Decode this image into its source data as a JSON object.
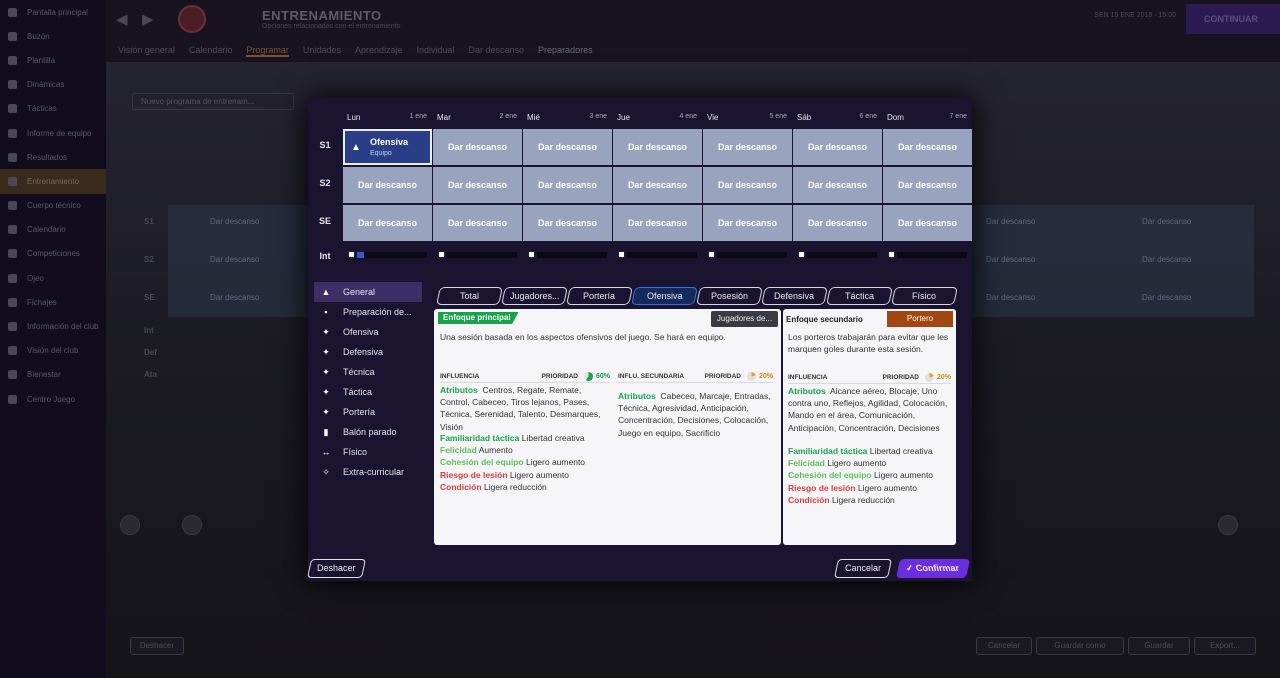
{
  "background": {
    "sidebar_items": [
      "Pantalla principal",
      "Buzón",
      "Plantilla",
      "Dinámicas",
      "Tácticas",
      "Informe de equipo",
      "Resultados",
      "Entrenamiento",
      "Cuerpo técnico",
      "Calendario",
      "Competiciones",
      "Ojeo",
      "Fichajes",
      "Información del club",
      "Visión del club",
      "Bienestar",
      "Centro Juego"
    ],
    "active_index": 7,
    "title": "ENTRENAMIENTO",
    "subtitle": "Opciones relacionadas con el entrenamiento",
    "top_right": "SEN   15 ENE 2018  ·  15:00",
    "confirm_label": "CONTINUAR",
    "tabs": [
      "Visión general",
      "Calendario",
      "Programar",
      "Unidades",
      "Aprendizaje",
      "Individual",
      "Dar descanso",
      "Preparadores"
    ],
    "active_tab_index": 2,
    "dropdown": "Nuevo programa de entrenam...",
    "row_labels": [
      "S1",
      "S2",
      "SE",
      "Int",
      "Def",
      "Ata"
    ],
    "cell_text": "Dar descanso",
    "bottom_buttons": [
      "Deshacer",
      "Cancelar",
      "Guardar como",
      "Guardar",
      "Export..."
    ]
  },
  "calendar": {
    "days": [
      {
        "name": "Lun",
        "date": "1 ene"
      },
      {
        "name": "Mar",
        "date": "2 ene"
      },
      {
        "name": "Mié",
        "date": "3 ene"
      },
      {
        "name": "Jue",
        "date": "4 ene"
      },
      {
        "name": "Vie",
        "date": "5 ene"
      },
      {
        "name": "Sáb",
        "date": "6 ene"
      },
      {
        "name": "Dom",
        "date": "7 ene"
      }
    ],
    "rows": [
      {
        "label": "S1",
        "cells": [
          "Ofensiva",
          "Dar descanso",
          "Dar descanso",
          "Dar descanso",
          "Dar descanso",
          "Dar descanso",
          "Dar descanso"
        ]
      },
      {
        "label": "S2",
        "cells": [
          "Dar descanso",
          "Dar descanso",
          "Dar descanso",
          "Dar descanso",
          "Dar descanso",
          "Dar descanso",
          "Dar descanso"
        ]
      },
      {
        "label": "SE",
        "cells": [
          "Dar descanso",
          "Dar descanso",
          "Dar descanso",
          "Dar descanso",
          "Dar descanso",
          "Dar descanso",
          "Dar descanso"
        ]
      }
    ],
    "selected": {
      "title": "Ofensiva",
      "subtitle": "Equipo"
    },
    "intensity_label": "Int",
    "intensity": [
      0.1,
      0,
      0,
      0,
      0,
      0,
      0
    ]
  },
  "categories": [
    {
      "icon": "▲",
      "label": "General"
    },
    {
      "icon": "▪",
      "label": "Preparación de..."
    },
    {
      "icon": "✦",
      "label": "Ofensiva"
    },
    {
      "icon": "✦",
      "label": "Defensiva"
    },
    {
      "icon": "✦",
      "label": "Técnica"
    },
    {
      "icon": "✦",
      "label": "Táctica"
    },
    {
      "icon": "✦",
      "label": "Portería"
    },
    {
      "icon": "▮",
      "label": "Balón parado"
    },
    {
      "icon": "↔",
      "label": "Físico"
    },
    {
      "icon": "✧",
      "label": "Extra-curricular"
    }
  ],
  "filter_tabs": [
    "Total",
    "Jugadores...",
    "Portería",
    "Ofensiva",
    "Posesión",
    "Defensiva",
    "Táctica",
    "Físico"
  ],
  "active_filter_index": 3,
  "main_panel": {
    "tag": "Enfoque principal",
    "chip": "Jugadores de...",
    "description": "Una sesión basada en los aspectos ofensivos del juego. Se hará en equipo.",
    "influence_label": "INFLUENCIA",
    "priority_label": "PRIORIDAD",
    "priority_value": "60%",
    "attributes_label": "Atributos",
    "attributes": "Centros, Regate, Remate, Control, Cabeceo, Tiros lejanos, Pases, Técnica, Serenidad, Talento, Desmarques, Visión",
    "effects": [
      {
        "key": "Familiaridad táctica",
        "value": "Libertad creativa",
        "tone": "green"
      },
      {
        "key": "Felicidad",
        "value": "Aumento",
        "tone": "lgreen"
      },
      {
        "key": "Cohesión del equipo",
        "value": "Ligero aumento",
        "tone": "lgreen"
      },
      {
        "key": "Riesgo de lesión",
        "value": "Ligero aumento",
        "tone": "red"
      },
      {
        "key": "Condición",
        "value": "Ligera reducción",
        "tone": "red"
      }
    ],
    "secondary_influence_label": "INFLU. SECUNDARIA",
    "secondary_priority_label": "PRIORIDAD",
    "secondary_priority_value": "20%",
    "secondary_attributes_label": "Atributos",
    "secondary_attributes": "Cabeceo, Marcaje, Entradas, Técnica, Agresividad, Anticipación, Concentración, Decisiones, Colocación, Juego en equipo, Sacrificio"
  },
  "secondary_panel": {
    "label": "Enfoque secundario",
    "chip": "Portero",
    "description": "Los porteros trabajarán para evitar que les marquen goles durante esta sesión.",
    "influence_label": "INFLUENCIA",
    "priority_label": "PRIORIDAD",
    "priority_value": "20%",
    "attributes_label": "Atributos",
    "attributes": "Alcance aéreo, Blocaje, Uno contra uno, Reflejos, Agilidad, Colocación, Mando en el área, Comunicación, Anticipación, Concentración, Decisiones",
    "effects": [
      {
        "key": "Familiaridad táctica",
        "value": "Libertad creativa",
        "tone": "green"
      },
      {
        "key": "Felicidad",
        "value": "Ligero aumento",
        "tone": "lgreen"
      },
      {
        "key": "Cohesión del equipo",
        "value": "Ligero aumento",
        "tone": "lgreen"
      },
      {
        "key": "Riesgo de lesión",
        "value": "Ligero aumento",
        "tone": "red"
      },
      {
        "key": "Condición",
        "value": "Ligera reducción",
        "tone": "red"
      }
    ]
  },
  "footer": {
    "undo": "Deshacer",
    "cancel": "Cancelar",
    "confirm": "Confirmar"
  },
  "colors": {
    "accent": "#6a2ee0",
    "selected_cell": "#2a3d87",
    "cell": "#98a3bd",
    "positive": "#16a34a",
    "negative": "#dc3b3b",
    "secondary_chip": "#a34712"
  }
}
